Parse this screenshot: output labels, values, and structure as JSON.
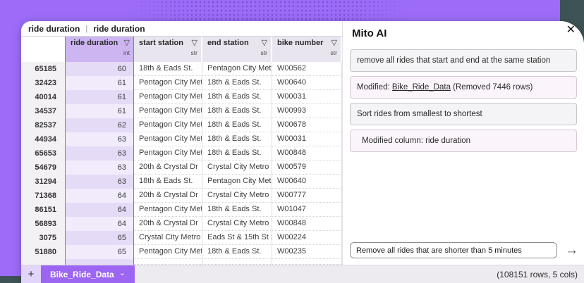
{
  "formula_bar": {
    "selected_cell": "ride duration",
    "separator": "|",
    "formula": "ride duration"
  },
  "grid": {
    "columns": [
      {
        "name": "ride duration",
        "dtype": "int",
        "selected": true,
        "filter_icon": "▽"
      },
      {
        "name": "start station",
        "dtype": "str",
        "selected": false,
        "filter_icon": "▽"
      },
      {
        "name": "end station",
        "dtype": "str",
        "selected": false,
        "filter_icon": "▽"
      },
      {
        "name": "bike number",
        "dtype": "str",
        "selected": false,
        "filter_icon": "▽"
      }
    ],
    "rows": [
      {
        "index": "65185",
        "ride_duration": "60",
        "start_station": "18th & Eads St.",
        "end_station": "Pentagon City Met…",
        "bike_number": "W00562"
      },
      {
        "index": "32423",
        "ride_duration": "61",
        "start_station": "Pentagon City Met…",
        "end_station": "18th & Eads St.",
        "bike_number": "W00640"
      },
      {
        "index": "40014",
        "ride_duration": "61",
        "start_station": "Pentagon City Met…",
        "end_station": "18th & Eads St.",
        "bike_number": "W00031"
      },
      {
        "index": "34537",
        "ride_duration": "61",
        "start_station": "Pentagon City Met…",
        "end_station": "18th & Eads St.",
        "bike_number": "W00993"
      },
      {
        "index": "82537",
        "ride_duration": "62",
        "start_station": "Pentagon City Met…",
        "end_station": "18th & Eads St.",
        "bike_number": "W00678"
      },
      {
        "index": "44934",
        "ride_duration": "63",
        "start_station": "Pentagon City Met…",
        "end_station": "18th & Eads St.",
        "bike_number": "W00031"
      },
      {
        "index": "65653",
        "ride_duration": "63",
        "start_station": "Pentagon City Met…",
        "end_station": "18th & Eads St.",
        "bike_number": "W00848"
      },
      {
        "index": "54679",
        "ride_duration": "63",
        "start_station": "20th & Crystal Dr",
        "end_station": "Crystal City Metro …",
        "bike_number": "W00579"
      },
      {
        "index": "31294",
        "ride_duration": "63",
        "start_station": "18th & Eads St.",
        "end_station": "Pentagon City Met…",
        "bike_number": "W00640"
      },
      {
        "index": "71368",
        "ride_duration": "64",
        "start_station": "20th & Crystal Dr",
        "end_station": "Crystal City Metro …",
        "bike_number": "W00777"
      },
      {
        "index": "86151",
        "ride_duration": "64",
        "start_station": "Pentagon City Met…",
        "end_station": "18th & Eads St.",
        "bike_number": "W01047"
      },
      {
        "index": "56893",
        "ride_duration": "64",
        "start_station": "20th & Crystal Dr",
        "end_station": "Crystal City Metro …",
        "bike_number": "W00848"
      },
      {
        "index": "3075",
        "ride_duration": "65",
        "start_station": "Crystal City Metro …",
        "end_station": "Eads St & 15th St S",
        "bike_number": "W00224"
      },
      {
        "index": "51880",
        "ride_duration": "65",
        "start_station": "Pentagon City Met…",
        "end_station": "18th & Eads St.",
        "bike_number": "W00235"
      }
    ]
  },
  "ai_panel": {
    "title": "Mito AI",
    "close_icon": "✕",
    "messages": [
      {
        "role": "user",
        "text": "remove all rides that start and end at the same station"
      },
      {
        "role": "assistant",
        "prefix": "Modified: ",
        "link": "Bike_Ride_Data",
        "suffix": " (Removed 7446 rows)"
      },
      {
        "role": "user",
        "text": "Sort rides from smallest to shortest"
      },
      {
        "role": "assistant",
        "text": "Modified column: ride duration"
      }
    ],
    "input_value": "Remove all rides that are shorter than 5 minutes",
    "send_icon": "→"
  },
  "footer": {
    "add_sheet_label": "+",
    "sheet_tab_label": "Bike_Ride_Data",
    "sheet_tab_chevron": "⌄",
    "status": "(108151 rows, 5 cols)"
  },
  "colors": {
    "page_background": "#3e5356",
    "accent_purple": "#9c6cf8",
    "selected_column_header": "#ccb5f1",
    "selected_column_border": "#9466ef",
    "footer_tab": "#9c66f3"
  }
}
